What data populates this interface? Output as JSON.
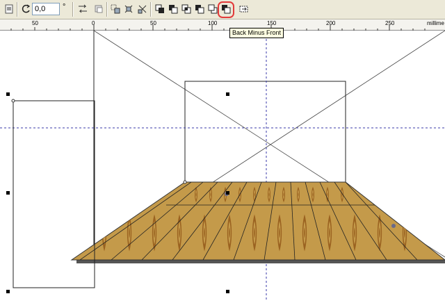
{
  "toolbar": {
    "rotation_value": "0,0",
    "rotation_unit": "°",
    "buttons": [
      "lock-ratio",
      "rotate",
      "mirror-horizontal",
      "mirror-vertical",
      "combine",
      "break-apart",
      "group",
      "ungroup",
      "weld",
      "trim",
      "intersect",
      "simplify",
      "front-minus-back",
      "back-minus-front",
      "create-boundary"
    ]
  },
  "tooltip": {
    "text": "Back Minus Front"
  },
  "ruler": {
    "labels": [
      "50",
      "0",
      "50",
      "100",
      "150",
      "200",
      "250",
      "millime"
    ]
  },
  "colors": {
    "wood_base": "#c49a4a",
    "wood_dark": "#9a6220",
    "guide": "#3a3aaa",
    "highlight": "#e23a3a"
  }
}
